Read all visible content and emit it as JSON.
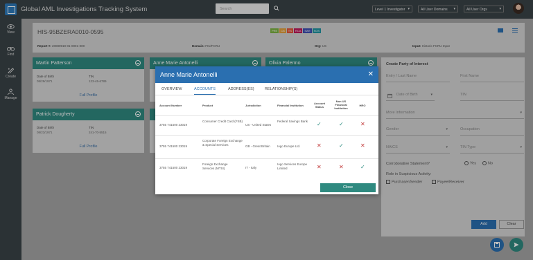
{
  "app": {
    "title": "Global AML Investigations Tracking System"
  },
  "search": {
    "placeholder": "Search"
  },
  "header": {
    "dropdowns": [
      "Level 1 Investigator",
      "All User Domains",
      "All User Orgs"
    ]
  },
  "nav": [
    {
      "label": "View"
    },
    {
      "label": "Find"
    },
    {
      "label": "Create"
    },
    {
      "label": "Manage"
    }
  ],
  "investigation": {
    "id": "HIS-95BZERA0010-0595",
    "badges": [
      {
        "text": "PRE",
        "color": "#7cb342"
      },
      {
        "text": "CB",
        "color": "#e6a23c"
      },
      {
        "text": "TS",
        "color": "#e65a3c"
      },
      {
        "text": "RCA",
        "color": "#c2185b"
      },
      {
        "text": "SAR",
        "color": "#3f51b5"
      },
      {
        "text": "SOS",
        "color": "#2196a3"
      }
    ],
    "report_label": "Report #:",
    "report_value": "20080919-01-0001-000",
    "domain_label": "Domain:",
    "domain_value": "FIU/FCRU",
    "org_label": "Org:",
    "org_value": "US",
    "input_label": "Input:",
    "input_value": "Historic FCRU Input"
  },
  "cards": [
    {
      "name": "Martin Patterson",
      "dob_label": "Date of Birth",
      "dob": "08/29/1971",
      "tin_label": "TIN",
      "tin": "123-45-6789",
      "link": "Full Profile"
    },
    {
      "name": "Anne Marie Antonelli"
    },
    {
      "name": "Olivia Palermo"
    },
    {
      "name": "Patrick Dougherty",
      "dob_label": "Date of Birth",
      "dob": "08/23/1971",
      "tin_label": "TIN",
      "tin": "241-70-5515",
      "link": "Full Profile"
    },
    {
      "name": ""
    },
    {
      "name": ""
    }
  ],
  "poi": {
    "title": "Create Party of Interest",
    "entry_last_name": "Entry / Last Name",
    "first_name": "First Name",
    "dob": "Date of Birth",
    "tin": "TIN",
    "more_info": "More Information",
    "gender": "Gender",
    "occupation": "Occupation",
    "naics": "NAICS",
    "tin_type": "TIN Type",
    "corroborative": "Corroborative Statement?",
    "yes": "Yes",
    "no": "No",
    "role": "Role in Suspicious Activity:",
    "purchaser": "Purchaser/Sender",
    "payee": "Payee/Receiver",
    "add": "Add",
    "clear": "Clear"
  },
  "modal": {
    "title": "Anne Marie Antonelli",
    "tabs": [
      "OVERVIEW",
      "ACCOUNTS",
      "ADDRESS(ES)",
      "RELATIONSHIP(S)"
    ],
    "active_tab": "ACCOUNTS",
    "columns": [
      "Account Number",
      "Product",
      "Jurisdiction",
      "Financial Institution",
      "Account Status",
      "Non US Financial Institution",
      "HRO"
    ],
    "rows": [
      {
        "account": "3755 741500 23019",
        "product": "Consumer Credit Card (FSB)",
        "jurisdiction": "US - United States",
        "institution": "Federal Savings Bank",
        "status": true,
        "non_us": true,
        "hro": false
      },
      {
        "account": "3755 741500 23019",
        "product": "Corporate Foreign Exchange & Special Services",
        "jurisdiction": "GB - Great Britain",
        "institution": "Iogo Europe Ltd.",
        "status": false,
        "non_us": true,
        "hro": false
      },
      {
        "account": "3755 741500 23019",
        "product": "Foreign Exchange Services (MTSI)",
        "jurisdiction": "IT - Italy",
        "institution": "Iogo Services Europe Limited",
        "status": false,
        "non_us": false,
        "hro": true
      }
    ],
    "close_label": "Close"
  },
  "colors": {
    "brand_blue": "#2a6fb0",
    "teal": "#2f8a80",
    "sidebar": "#3a4347"
  }
}
